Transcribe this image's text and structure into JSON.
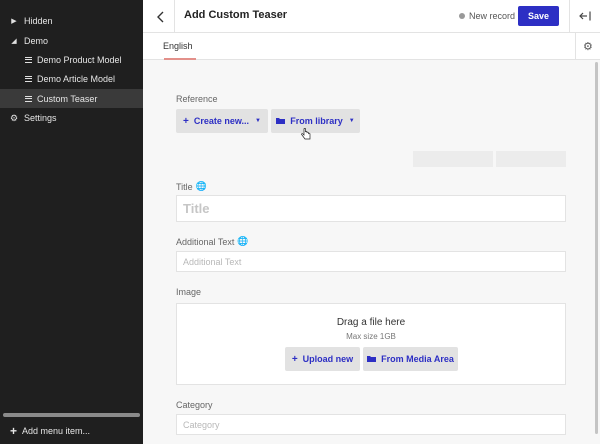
{
  "sidebar": {
    "items": [
      {
        "label": "Hidden",
        "icon": "triangle-right-icon"
      },
      {
        "label": "Demo",
        "icon": "triangle-down-icon"
      },
      {
        "label": "Demo Product Model",
        "icon": "list-icon"
      },
      {
        "label": "Demo Article Model",
        "icon": "list-icon"
      },
      {
        "label": "Custom Teaser",
        "icon": "list-icon",
        "active": true
      },
      {
        "label": "Settings",
        "icon": "gear-icon"
      }
    ],
    "add_menu_item": "Add menu item..."
  },
  "header": {
    "title": "Add Custom Teaser",
    "status": "New record",
    "save_label": "Save"
  },
  "tabs": {
    "items": [
      "English"
    ]
  },
  "form": {
    "reference": {
      "label": "Reference",
      "create_new": "Create new...",
      "from_library": "From library"
    },
    "title_field": {
      "label": "Title",
      "placeholder": "Title"
    },
    "additional_text": {
      "label": "Additional Text",
      "placeholder": "Additional Text"
    },
    "image": {
      "label": "Image",
      "drag_text": "Drag a file here",
      "max_size": "Max size 1GB",
      "upload_new": "Upload new",
      "from_media_area": "From Media Area"
    },
    "category": {
      "label": "Category",
      "placeholder": "Category"
    }
  },
  "colors": {
    "accent": "#2d2fc4",
    "sidebar_bg": "#1f1f1f",
    "tab_underline": "#e3908a"
  }
}
